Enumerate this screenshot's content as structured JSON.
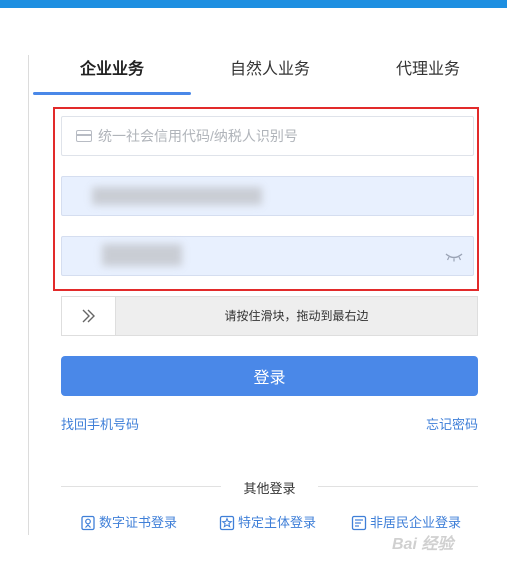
{
  "colors": {
    "accent": "#4a88e8",
    "top_bar": "#1e8fe1",
    "highlight_frame": "#e22a2a",
    "link": "#3f7fd8"
  },
  "tabs": [
    {
      "label": "企业业务",
      "active": true
    },
    {
      "label": "自然人业务",
      "active": false
    },
    {
      "label": "代理业务",
      "active": false
    }
  ],
  "form": {
    "credit_code": {
      "placeholder": "统一社会信用代码/纳税人识别号",
      "value": "",
      "icon": "card-icon"
    },
    "account": {
      "value": ""
    },
    "password": {
      "value": "",
      "icon": "eye-closed-icon"
    }
  },
  "slider": {
    "text": "请按住滑块，拖动到最右边",
    "icon": "double-chevron-right-icon"
  },
  "login_label": "登录",
  "links": {
    "recover_phone": "找回手机号码",
    "forgot_password": "忘记密码"
  },
  "other_login": {
    "label": "其他登录",
    "options": [
      {
        "label": "数字证书登录",
        "icon": "certificate-icon"
      },
      {
        "label": "特定主体登录",
        "icon": "star-badge-icon"
      },
      {
        "label": "非居民企业登录",
        "icon": "id-card-icon"
      }
    ]
  },
  "watermark": "Bai 经验"
}
